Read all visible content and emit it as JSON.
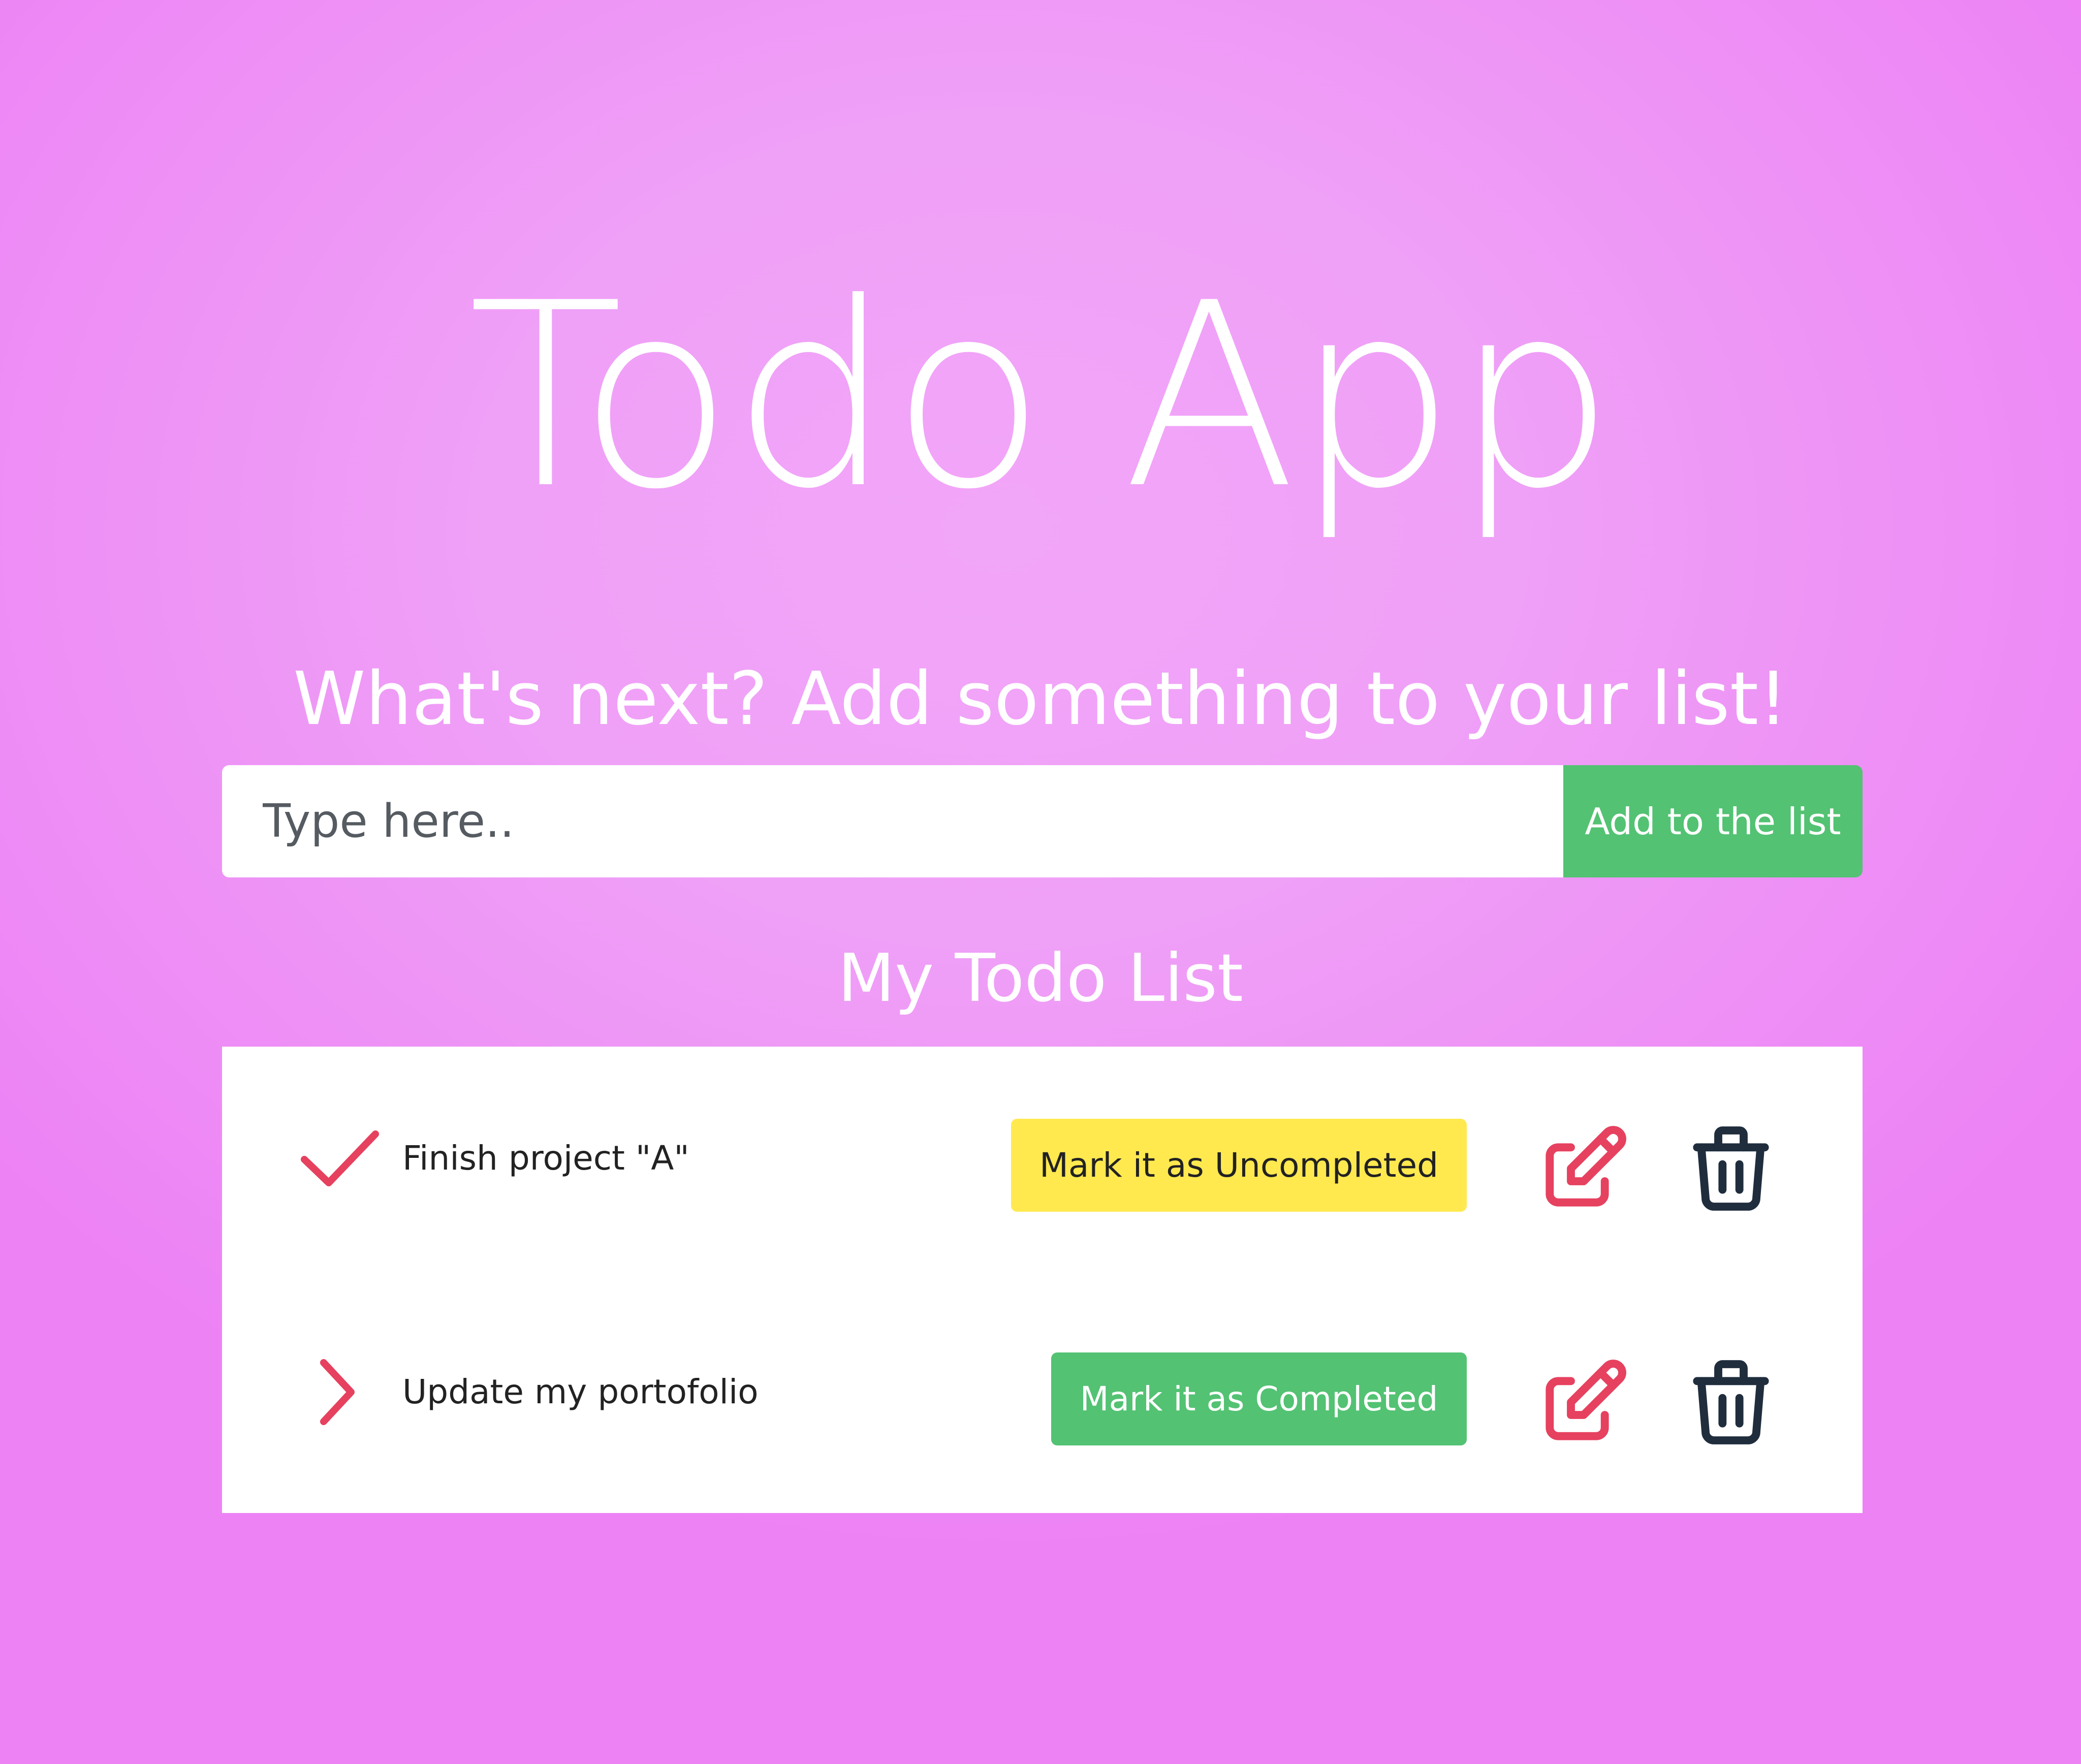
{
  "app": {
    "title": "Todo App",
    "prompt": "What's next? Add something to your list!"
  },
  "form": {
    "input_value": "",
    "input_placeholder": "Type here..",
    "add_button_label": "Add to the list"
  },
  "list": {
    "title": "My Todo List",
    "items": [
      {
        "text": "Finish project \"A\"",
        "completed": true,
        "status_icon": "check-icon",
        "toggle_label": "Mark it as Uncompleted",
        "edit_icon": "edit-icon",
        "delete_icon": "trash-icon"
      },
      {
        "text": "Update my portofolio",
        "completed": false,
        "status_icon": "chevron-right-icon",
        "toggle_label": "Mark it as Completed",
        "edit_icon": "edit-icon",
        "delete_icon": "trash-icon"
      }
    ]
  },
  "colors": {
    "background": "#ef8df6",
    "accent_green": "#53c273",
    "accent_yellow": "#ffe94f",
    "icon_red": "#e6415f",
    "icon_dark": "#1f2d3d"
  }
}
